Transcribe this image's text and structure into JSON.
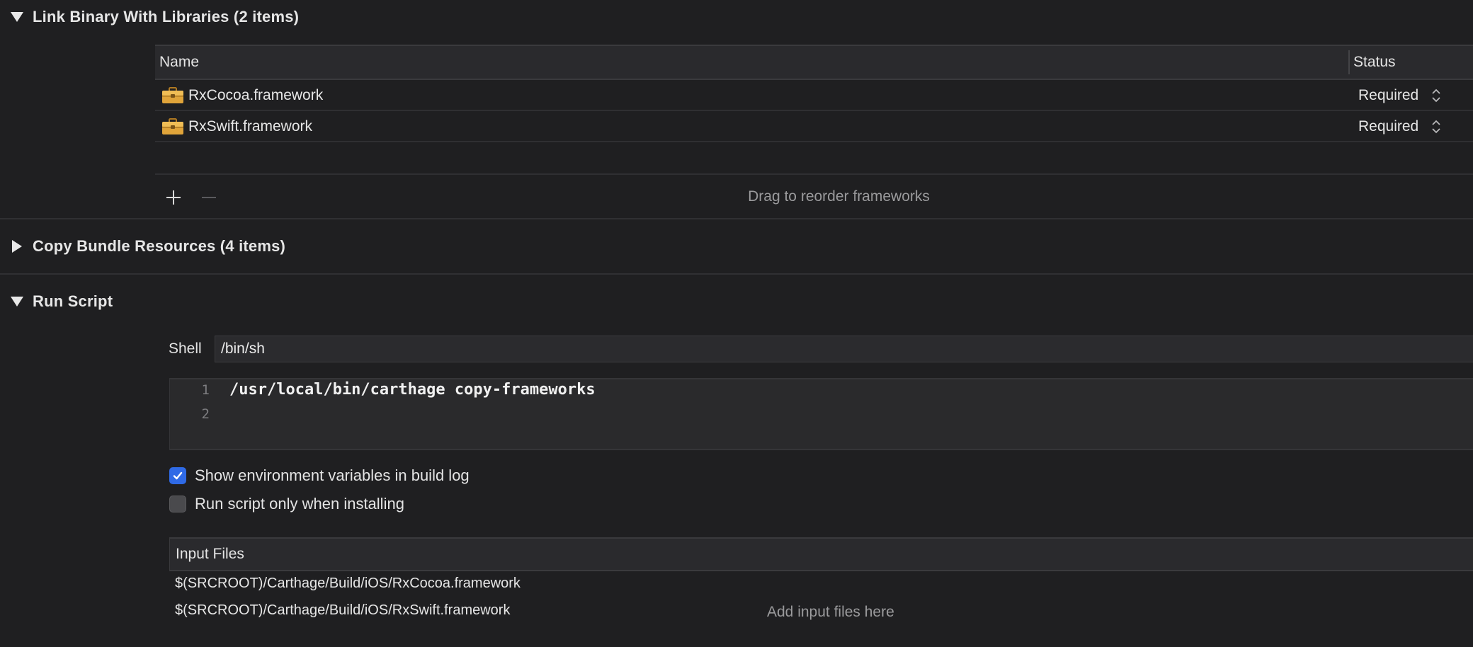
{
  "link_section": {
    "title": "Link Binary With Libraries (2 items)",
    "table": {
      "col_name": "Name",
      "col_status": "Status",
      "rows": [
        {
          "name": "RxCocoa.framework",
          "status": "Required",
          "icon": "toolbox-icon"
        },
        {
          "name": "RxSwift.framework",
          "status": "Required",
          "icon": "toolbox-icon"
        }
      ],
      "footer_hint": "Drag to reorder frameworks"
    }
  },
  "copy_section": {
    "title": "Copy Bundle Resources (4 items)"
  },
  "run_script": {
    "title": "Run Script",
    "shell_label": "Shell",
    "shell_value": "/bin/sh",
    "lines": [
      {
        "no": "1",
        "code": "/usr/local/bin/carthage copy-frameworks"
      },
      {
        "no": "2",
        "code": ""
      }
    ],
    "options": [
      {
        "label": "Show environment variables in build log",
        "checked": true
      },
      {
        "label": "Run script only when installing",
        "checked": false
      }
    ],
    "input_files": {
      "header": "Input Files",
      "files": [
        "$(SRCROOT)/Carthage/Build/iOS/RxCocoa.framework",
        "$(SRCROOT)/Carthage/Build/iOS/RxSwift.framework"
      ],
      "hint": "Add input files here"
    }
  },
  "colors": {
    "background": "#1f1f21",
    "checkbox_on": "#2f6ae6",
    "toolbox": "#e0a43a"
  }
}
